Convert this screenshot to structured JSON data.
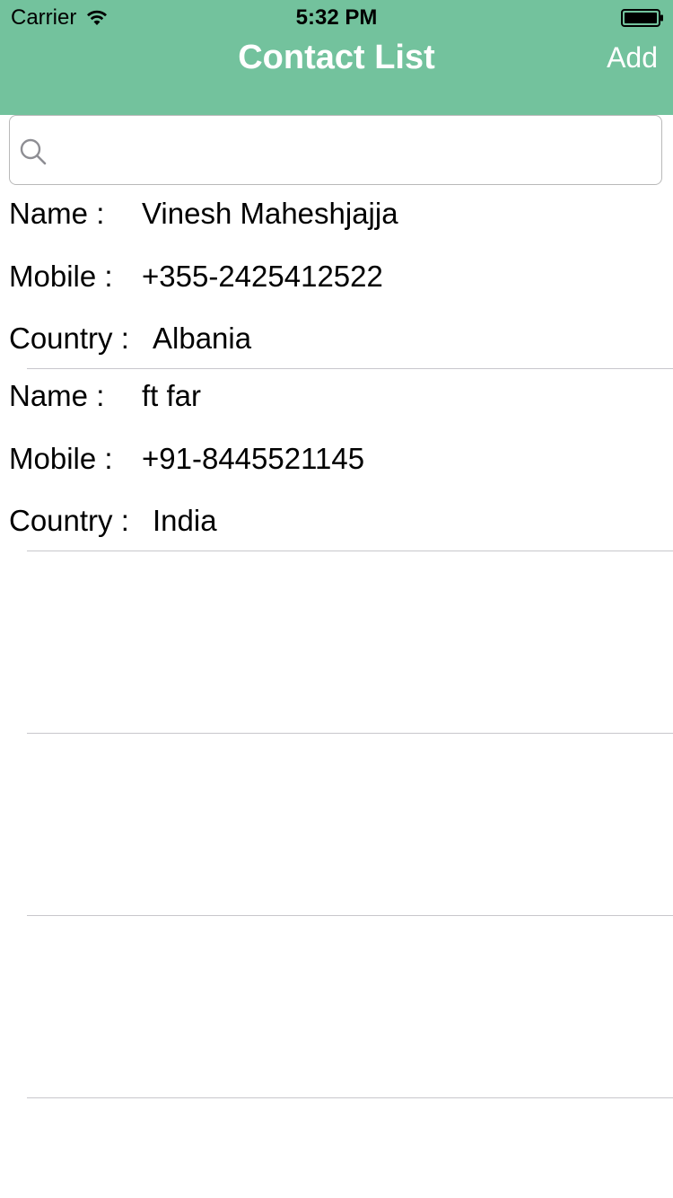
{
  "status_bar": {
    "carrier": "Carrier",
    "time": "5:32 PM"
  },
  "nav": {
    "title": "Contact List",
    "add_label": "Add"
  },
  "search": {
    "value": "",
    "placeholder": ""
  },
  "labels": {
    "name": "Name :",
    "mobile": "Mobile :",
    "country": "Country :"
  },
  "contacts": [
    {
      "name": "Vinesh Maheshjajja",
      "mobile": "+355-2425412522",
      "country": "Albania"
    },
    {
      "name": "ft far",
      "mobile": "+91-8445521145",
      "country": "India"
    }
  ],
  "colors": {
    "nav_background": "#73c29d",
    "separator": "#c8c7cc"
  }
}
